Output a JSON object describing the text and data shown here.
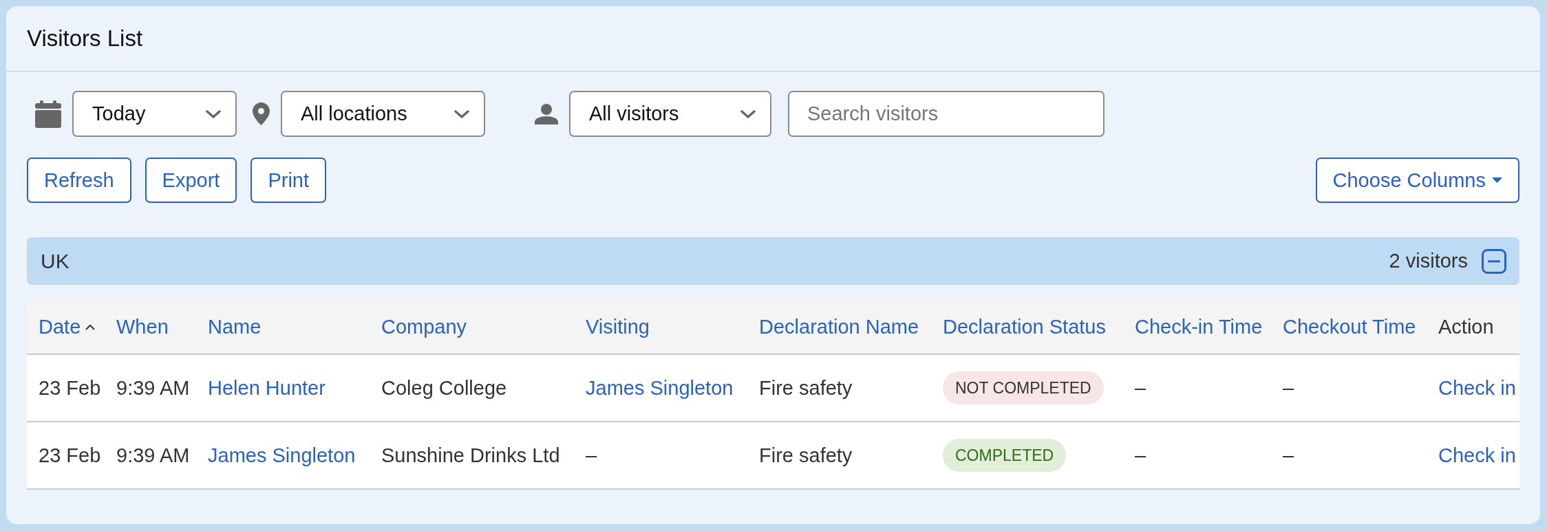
{
  "window": {
    "title": "Visitors List"
  },
  "filters": [
    {
      "kind": "date",
      "value": "Today"
    },
    {
      "kind": "location",
      "value": "All locations"
    },
    {
      "kind": "visitor",
      "value": "All visitors"
    }
  ],
  "search": {
    "placeholder": "Search visitors"
  },
  "toolbar": {
    "buttons": [
      "Refresh",
      "Export",
      "Print"
    ],
    "column_chooser": "Choose Columns"
  },
  "groups": [
    {
      "name": "UK",
      "count": "2 visitors",
      "expanded": true,
      "columns": [
        {
          "label": "Date",
          "sortable": true,
          "sorted": true
        },
        {
          "label": "When",
          "sortable": true,
          "sorted": false
        },
        {
          "label": "Name",
          "sortable": true,
          "sorted": false
        },
        {
          "label": "Company",
          "sortable": true,
          "sorted": false
        },
        {
          "label": "Visiting",
          "sortable": true,
          "sorted": false
        },
        {
          "label": "Declaration Name",
          "sortable": true,
          "sorted": false
        },
        {
          "label": "Declaration Status",
          "sortable": true,
          "sorted": false
        },
        {
          "label": "Check-in Time",
          "sortable": true,
          "sorted": false
        },
        {
          "label": "Checkout Time",
          "sortable": true,
          "sorted": false
        },
        {
          "label": "Action",
          "sortable": false,
          "sorted": false
        }
      ],
      "rows": [
        {
          "date": "23 Feb",
          "when": "9:39 AM",
          "name": "Helen Hunter",
          "company": "Coleg College",
          "visiting": {
            "text": "James Singleton",
            "link": true
          },
          "declaration_name": "Fire safety",
          "declaration_status": {
            "label": "NOT COMPLETED",
            "kind": "incomplete"
          },
          "check_in_time": "–",
          "checkout_time": "–",
          "action": "Check in"
        },
        {
          "date": "23 Feb",
          "when": "9:39 AM",
          "name": "James Singleton",
          "company": "Sunshine Drinks Ltd",
          "visiting": {
            "text": "–",
            "link": false
          },
          "declaration_name": "Fire safety",
          "declaration_status": {
            "label": "COMPLETED",
            "kind": "complete"
          },
          "check_in_time": "–",
          "checkout_time": "–",
          "action": "Check in"
        }
      ]
    }
  ]
}
